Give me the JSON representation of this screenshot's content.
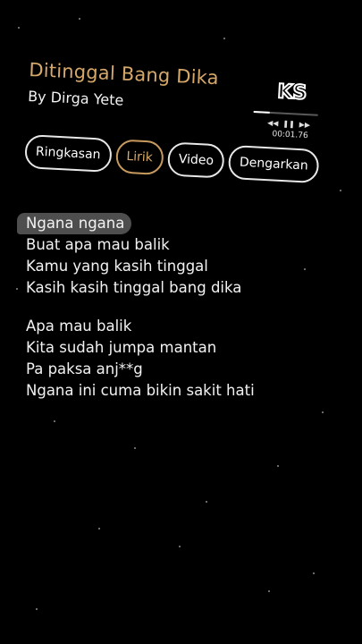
{
  "song": {
    "title": "Ditinggal Bang Dika",
    "artist_line": "By Dirga Yete"
  },
  "logo": {
    "text": "KS"
  },
  "player": {
    "timecode": "00:01.76",
    "progress_fraction": 0.25,
    "prev_icon": "skip-back-icon",
    "pause_icon": "pause-icon",
    "next_icon": "skip-forward-icon"
  },
  "tabs": [
    {
      "label": "Ringkasan",
      "active": false
    },
    {
      "label": "Lirik",
      "active": true
    },
    {
      "label": "Video",
      "active": false
    },
    {
      "label": "Dengarkan",
      "active": false
    }
  ],
  "lyrics": {
    "stanza1": [
      "Ngana ngana",
      "Buat apa mau balik",
      "Kamu yang kasih tinggal",
      "Kasih kasih tinggal bang dika"
    ],
    "stanza2": [
      "Apa mau balik",
      "Kita sudah jumpa mantan",
      "Pa paksa anj**g",
      "Ngana ini cuma bikin sakit hati"
    ]
  },
  "colors": {
    "accent": "#d6a86a",
    "background": "#000000",
    "highlight": "#4e4e4e"
  }
}
